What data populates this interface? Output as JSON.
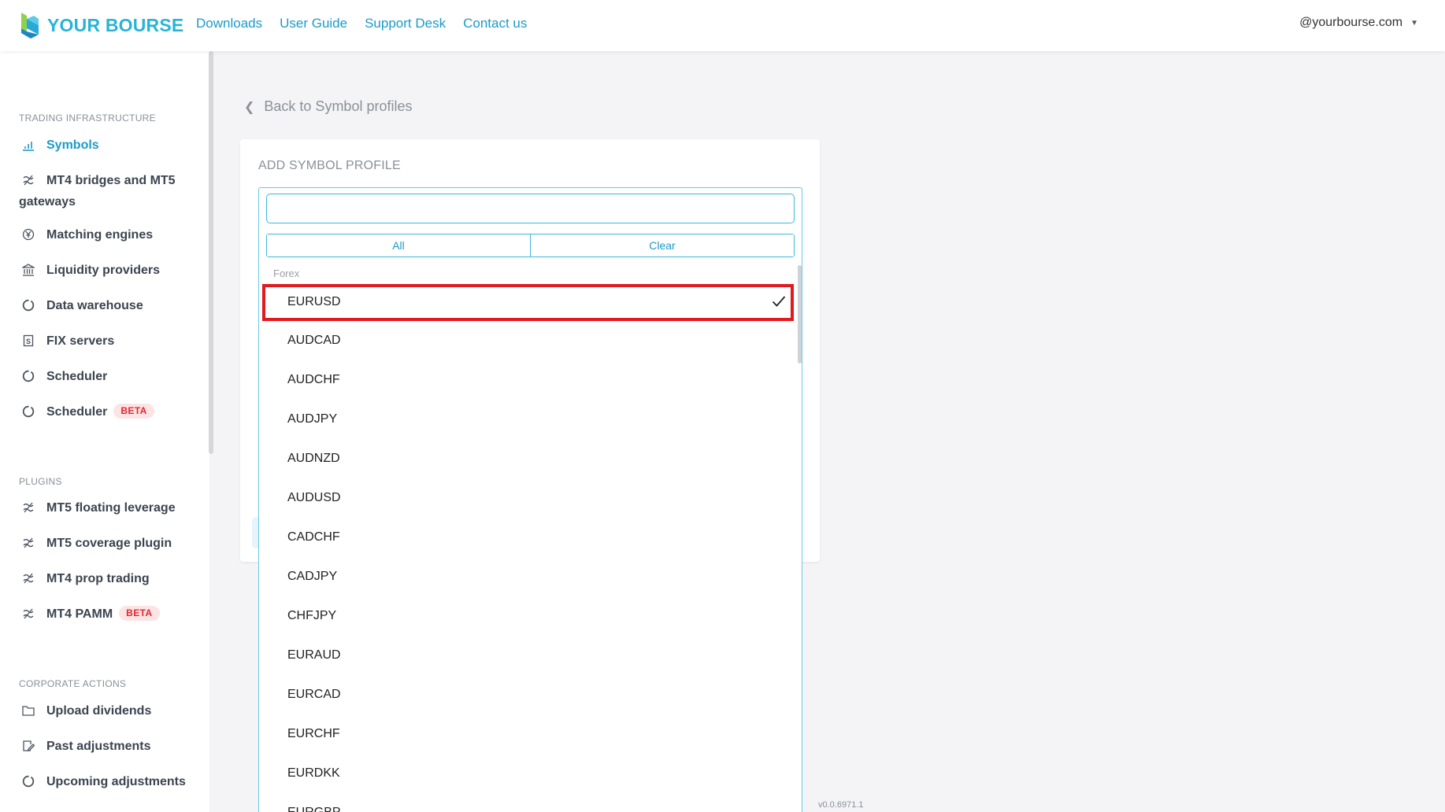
{
  "header": {
    "brand": "YOUR BOURSE",
    "nav": [
      {
        "label": "Downloads"
      },
      {
        "label": "User Guide"
      },
      {
        "label": "Support Desk"
      },
      {
        "label": "Contact us"
      }
    ],
    "user": "@yourbourse.com",
    "colors": {
      "brand": "#27b4d8",
      "link": "#1a9bc9"
    }
  },
  "sidebar": {
    "sections": [
      {
        "title": "TRADING INFRASTRUCTURE",
        "items": [
          {
            "label": "Symbols",
            "icon": "bar-chart-icon",
            "active": true
          },
          {
            "label": "MT4 bridges and MT5",
            "label2": "gateways",
            "icon": "bridge-icon"
          },
          {
            "label": "Matching engines",
            "icon": "yen-circle-icon"
          },
          {
            "label": "Liquidity providers",
            "icon": "bank-icon"
          },
          {
            "label": "Data warehouse",
            "icon": "circle-icon"
          },
          {
            "label": "FIX servers",
            "icon": "document-s-icon"
          },
          {
            "label": "Scheduler",
            "icon": "circle-icon"
          },
          {
            "label": "Scheduler",
            "icon": "circle-icon",
            "badge": "BETA"
          }
        ]
      },
      {
        "title": "PLUGINS",
        "items": [
          {
            "label": "MT5 floating leverage",
            "icon": "bridge-icon"
          },
          {
            "label": "MT5 coverage plugin",
            "icon": "bridge-icon"
          },
          {
            "label": "MT4 prop trading",
            "icon": "bridge-icon"
          },
          {
            "label": "MT4 PAMM",
            "icon": "bridge-icon",
            "badge": "BETA"
          }
        ]
      },
      {
        "title": "CORPORATE ACTIONS",
        "items": [
          {
            "label": "Upload dividends",
            "icon": "folder-icon"
          },
          {
            "label": "Past adjustments",
            "icon": "edit-document-icon"
          },
          {
            "label": "Upcoming adjustments",
            "icon": "circle-icon"
          }
        ]
      }
    ]
  },
  "main": {
    "back_link": "Back to Symbol profiles",
    "card_title": "ADD SYMBOL PROFILE",
    "dropdown": {
      "search_value": "",
      "all_label": "All",
      "clear_label": "Clear",
      "group_label": "Forex",
      "options": [
        {
          "label": "EURUSD",
          "selected": true
        },
        {
          "label": "AUDCAD"
        },
        {
          "label": "AUDCHF"
        },
        {
          "label": "AUDJPY"
        },
        {
          "label": "AUDNZD"
        },
        {
          "label": "AUDUSD"
        },
        {
          "label": "CADCHF"
        },
        {
          "label": "CADJPY"
        },
        {
          "label": "CHFJPY"
        },
        {
          "label": "EURAUD"
        },
        {
          "label": "EURCAD"
        },
        {
          "label": "EURCHF"
        },
        {
          "label": "EURDKK"
        },
        {
          "label": "EURGBP"
        }
      ],
      "highlight_color": "#e11a1f"
    },
    "version": "v0.0.6971.1"
  }
}
